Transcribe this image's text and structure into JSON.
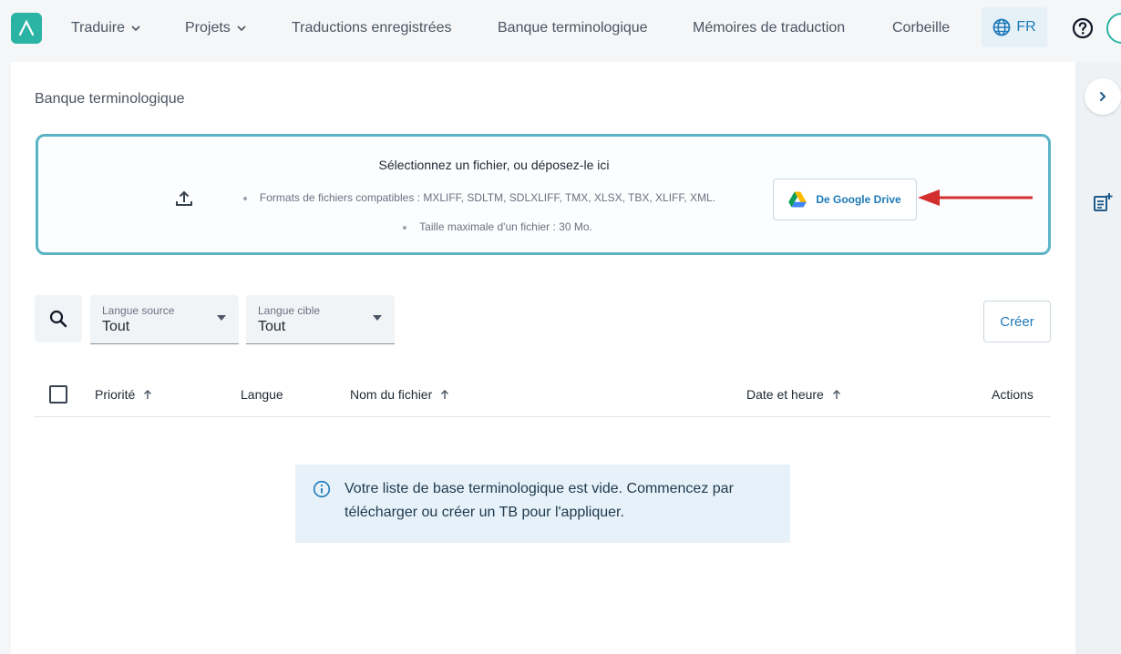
{
  "nav": {
    "items": [
      {
        "label": "Traduire",
        "dropdown": true
      },
      {
        "label": "Projets",
        "dropdown": true
      },
      {
        "label": "Traductions enregistrées",
        "dropdown": false
      },
      {
        "label": "Banque terminologique",
        "dropdown": false
      },
      {
        "label": "Mémoires de traduction",
        "dropdown": false
      },
      {
        "label": "Corbeille",
        "dropdown": false
      }
    ],
    "language": "FR"
  },
  "page": {
    "title": "Banque terminologique"
  },
  "dropzone": {
    "title": "Sélectionnez un fichier, ou déposez-le ici",
    "formats": "Formats de fichiers compatibles : MXLIFF, SDLTM, SDLXLIFF, TMX, XLSX, TBX, XLIFF, XML.",
    "max_size": "Taille maximale d'un fichier : 30 Mo.",
    "gdrive_label": "De Google Drive"
  },
  "filters": {
    "source": {
      "label": "Langue source",
      "value": "Tout"
    },
    "target": {
      "label": "Langue cible",
      "value": "Tout"
    },
    "create_label": "Créer"
  },
  "table": {
    "columns": [
      "Priorité",
      "Langue",
      "Nom du fichier",
      "Date et heure",
      "Actions"
    ]
  },
  "empty": {
    "message": "Votre liste de base terminologique est vide. Commencez par télécharger ou créer un TB pour l'appliquer."
  },
  "colors": {
    "accent": "#2bb3a3",
    "link": "#1e7bb8",
    "dropzone_border": "#5bb4c6",
    "annotation_arrow": "#d32f2f",
    "notice_bg": "#e6f1f9"
  }
}
